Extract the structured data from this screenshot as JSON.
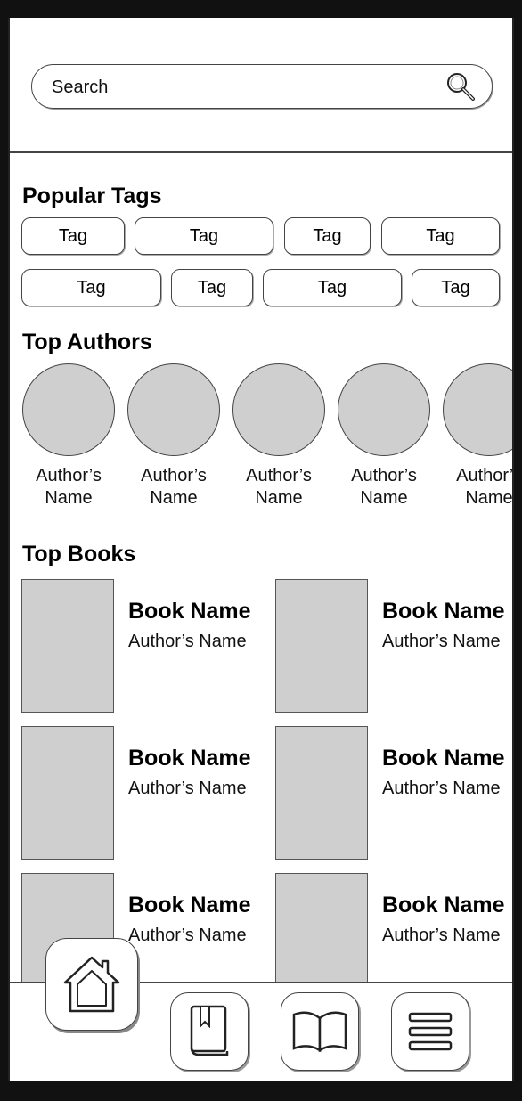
{
  "search": {
    "placeholder": "Search"
  },
  "sections": {
    "tags_title": "Popular Tags",
    "authors_title": "Top Authors",
    "books_title": "Top Books"
  },
  "tags": [
    "Tag",
    "Tag",
    "Tag",
    "Tag",
    "Tag",
    "Tag",
    "Tag",
    "Tag"
  ],
  "authors": [
    {
      "name": "Author’s\nName"
    },
    {
      "name": "Author’s\nName"
    },
    {
      "name": "Author’s\nName"
    },
    {
      "name": "Author’s\nName"
    },
    {
      "name": "Author’s\nName"
    }
  ],
  "books": [
    {
      "title": "Book Name",
      "author": "Author’s Name"
    },
    {
      "title": "Book Name",
      "author": "Author’s Name"
    },
    {
      "title": "Book Name",
      "author": "Author’s Name"
    },
    {
      "title": "Book Name",
      "author": "Author’s Name"
    },
    {
      "title": "Book Name",
      "author": "Author’s Name"
    },
    {
      "title": "Book Name",
      "author": "Author’s Name"
    }
  ],
  "nav": {
    "items": [
      "home-icon",
      "bookmarked-book-icon",
      "open-book-icon",
      "menu-icon"
    ]
  },
  "colors": {
    "placeholder_gray": "#cfcfcf",
    "outline": "#444444",
    "frame": "#111111"
  }
}
